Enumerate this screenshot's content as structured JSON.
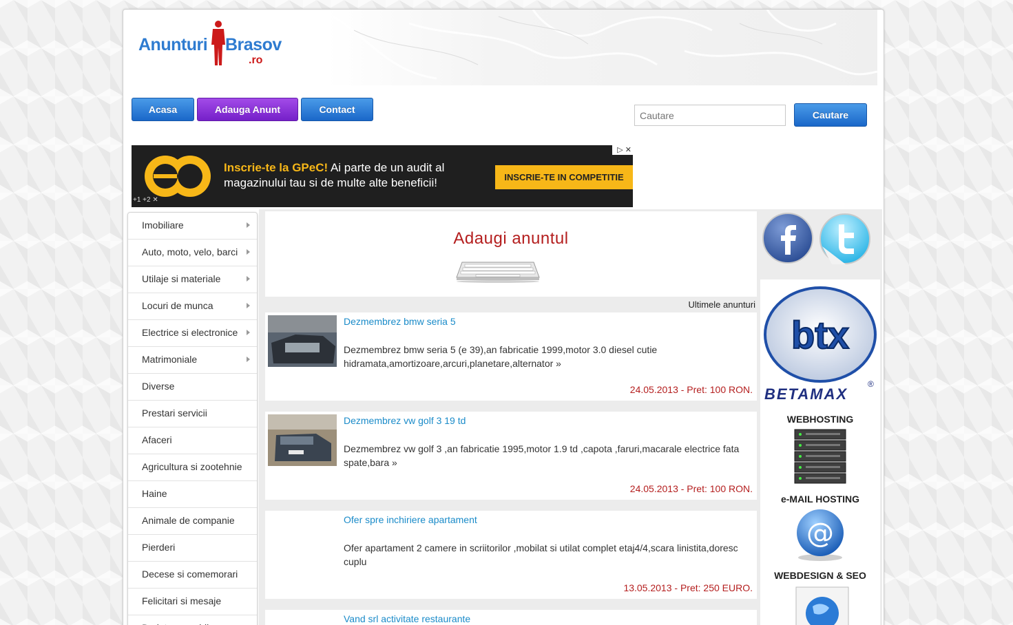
{
  "logo": {
    "word1": "Anunturi",
    "word2": "Brasov",
    "tld": ".ro"
  },
  "nav": {
    "home": "Acasa",
    "add": "Adauga Anunt",
    "contact": "Contact"
  },
  "search": {
    "placeholder": "Cautare",
    "button": "Cautare"
  },
  "ad": {
    "headline": "Inscrie-te la GPeC!",
    "text1": " Ai parte de un audit al",
    "text2": "magazinului tau si de multe alte beneficii!",
    "cta": "INSCRIE-TE IN COMPETITIE",
    "plus": "+1  +2  ✕"
  },
  "categories": [
    {
      "label": "Imobiliare",
      "sub": true
    },
    {
      "label": "Auto, moto, velo, barci",
      "sub": true
    },
    {
      "label": "Utilaje si materiale",
      "sub": true
    },
    {
      "label": "Locuri de munca",
      "sub": true
    },
    {
      "label": "Electrice si electronice",
      "sub": true
    },
    {
      "label": "Matrimoniale",
      "sub": true
    },
    {
      "label": "Diverse",
      "sub": false
    },
    {
      "label": "Prestari servicii",
      "sub": false
    },
    {
      "label": "Afaceri",
      "sub": false
    },
    {
      "label": "Agricultura si zootehnie",
      "sub": false
    },
    {
      "label": "Haine",
      "sub": false
    },
    {
      "label": "Animale de companie",
      "sub": false
    },
    {
      "label": "Pierderi",
      "sub": false
    },
    {
      "label": "Decese si comemorari",
      "sub": false
    },
    {
      "label": "Felicitari si mesaje",
      "sub": false
    },
    {
      "label": "De interes public",
      "sub": false
    }
  ],
  "add_box": {
    "title": "Adaugi anuntul"
  },
  "latest_label": "Ultimele anunturi",
  "listings": [
    {
      "title": "Dezmembrez bmw seria 5",
      "desc": "Dezmembrez bmw seria 5 (e 39),an fabricatie 1999,motor 3.0 diesel cutie hidramata,amortizoare,arcuri,planetare,alternator »",
      "meta": "24.05.2013 - Pret: 100 RON."
    },
    {
      "title": "Dezmembrez vw golf 3 19 td",
      "desc": "Dezmembrez vw golf 3 ,an fabricatie 1995,motor 1.9 td ,capota ,faruri,macarale electrice fata spate,bara »",
      "meta": "24.05.2013 - Pret: 100 RON."
    },
    {
      "title": "Ofer spre inchiriere apartament",
      "desc": "Ofer apartament 2 camere in scriitorilor ,mobilat si utilat complet etaj4/4,scara linistita,doresc cuplu",
      "meta": "13.05.2013 - Pret: 250 EURO."
    },
    {
      "title": "Vand srl activitate restaurante",
      "desc": "",
      "meta": ""
    }
  ],
  "promo": {
    "brand": "btx",
    "brand_full": "BETAMAX",
    "reg": "®",
    "webhosting": "WEBHOSTING",
    "email": "e-MAIL HOSTING",
    "webdesign": "WEBDESIGN & SEO"
  },
  "colors": {
    "accent_blue": "#2e7bd0",
    "accent_red": "#b41e1e",
    "link": "#1a8bc9",
    "purple": "#7520c9"
  }
}
